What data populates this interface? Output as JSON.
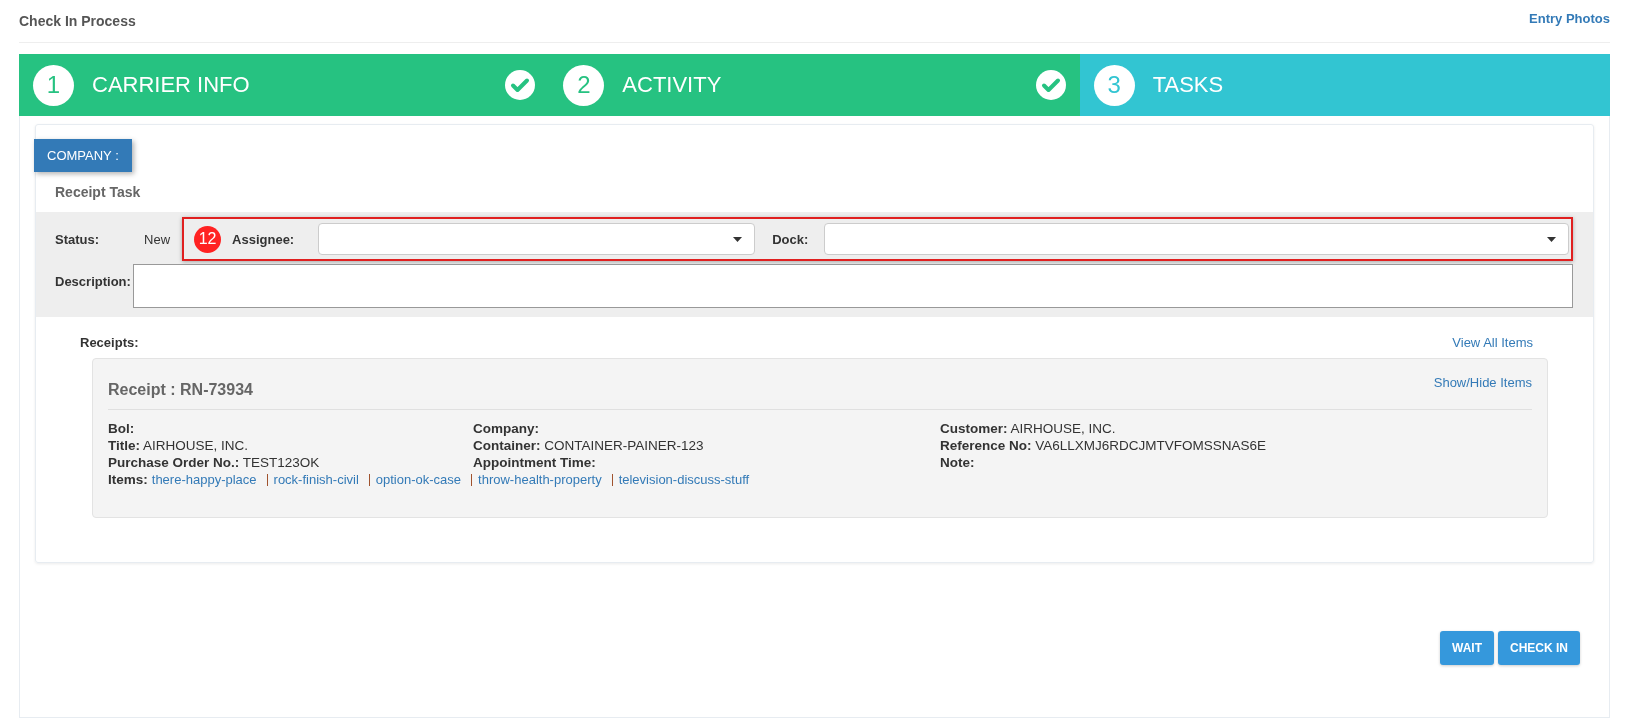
{
  "header": {
    "title": "Check In Process",
    "link": "Entry Photos"
  },
  "steps": [
    {
      "number": "1",
      "label": "CARRIER INFO",
      "completed": true,
      "selected": false
    },
    {
      "number": "2",
      "label": "ACTIVITY",
      "completed": true,
      "selected": false
    },
    {
      "number": "3",
      "label": "TASKS",
      "completed": false,
      "selected": true
    }
  ],
  "company_tag": "COMPANY :",
  "task": {
    "title": "Receipt Task",
    "status_label": "Status:",
    "status_value": "New",
    "highlighted": true,
    "highlight_number": "12",
    "assignee_label": "Assignee:",
    "dock_label": "Dock:",
    "description_label": "Description:"
  },
  "receipts": {
    "label": "Receipts:",
    "view_all": "View All Items",
    "receipt": {
      "title": "Receipt : RN-73934",
      "toggle": "Show/Hide Items",
      "fields": [
        {
          "label": "Bol:"
        },
        {
          "label": "Company:"
        },
        {
          "label": "Customer:",
          "value": "AIRHOUSE, INC."
        },
        {
          "label": "Title:",
          "value": "AIRHOUSE, INC."
        },
        {
          "label": "Container:",
          "value": "CONTAINER-PAINER-123"
        },
        {
          "label": "Reference No:",
          "value": "VA6LLXMJ6RDCJMTVFOMSSNAS6E"
        },
        {
          "label": "Purchase Order No.:",
          "value": "TEST123OK"
        },
        {
          "label": "Appointment Time:"
        },
        {
          "label": "Note:"
        }
      ],
      "items_label": "Items:",
      "items": [
        "there-happy-place",
        "rock-finish-civil",
        "option-ok-case",
        "throw-health-property",
        "television-discuss-stuff"
      ]
    }
  },
  "buttons": [
    "WAIT",
    "CHECK IN"
  ]
}
